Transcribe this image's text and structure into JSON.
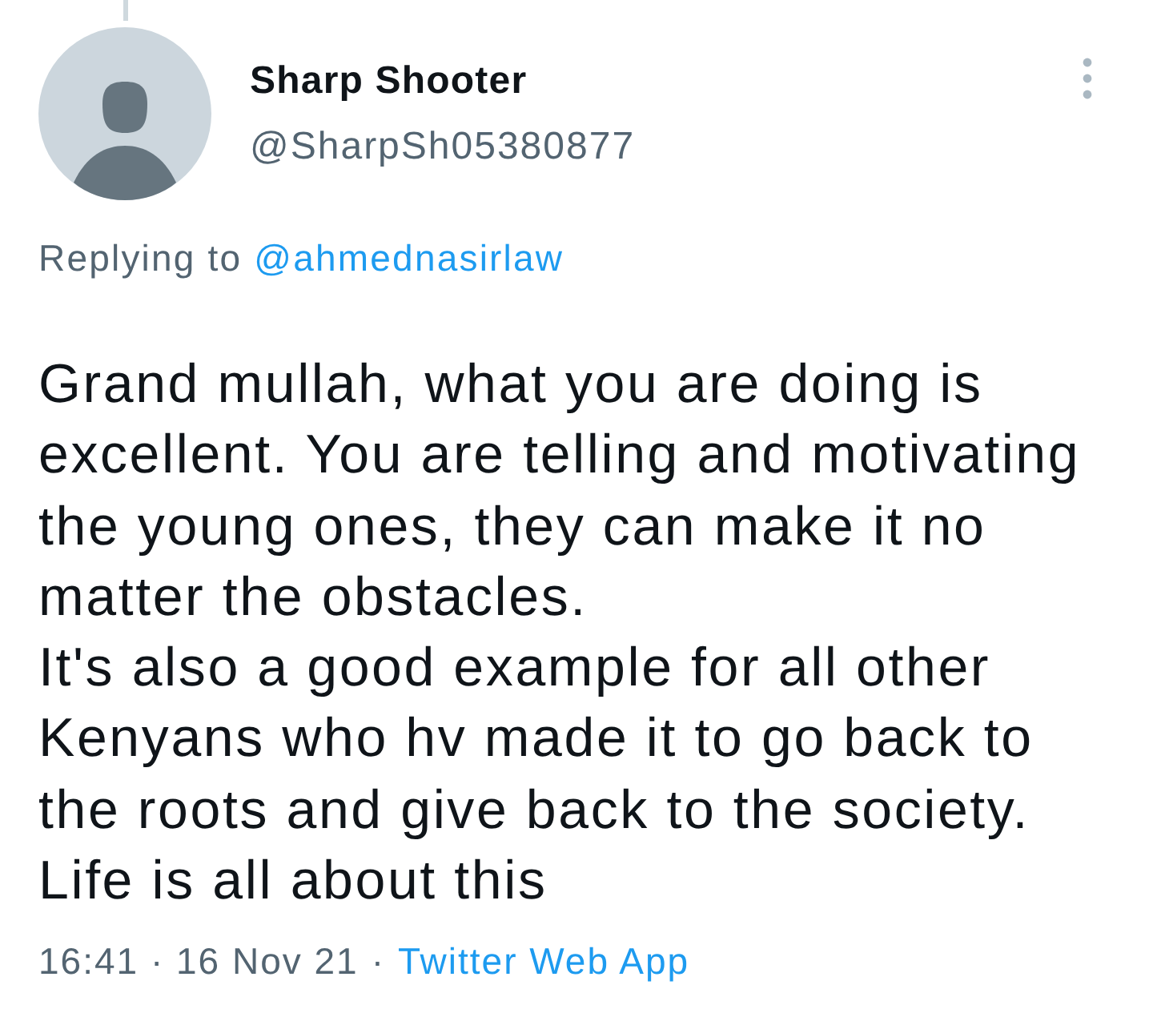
{
  "author": {
    "name": "Sharp Shooter",
    "handle": "@SharpSh05380877"
  },
  "reply_context": {
    "prefix": "Replying to",
    "mention": "@ahmednasirlaw"
  },
  "body": {
    "lines": [
      "Grand mullah, what you are doing is",
      "excellent. You are telling and motivating",
      "the young ones, they can make it no",
      "matter the obstacles.",
      "It's also a good example for all other",
      "Kenyans who hv made it to go back to",
      "the roots and give back to the society.",
      "Life is all about this"
    ]
  },
  "meta": {
    "timestamp": "16:41 · 16 Nov 21",
    "separator": "·",
    "source": "Twitter Web App"
  }
}
